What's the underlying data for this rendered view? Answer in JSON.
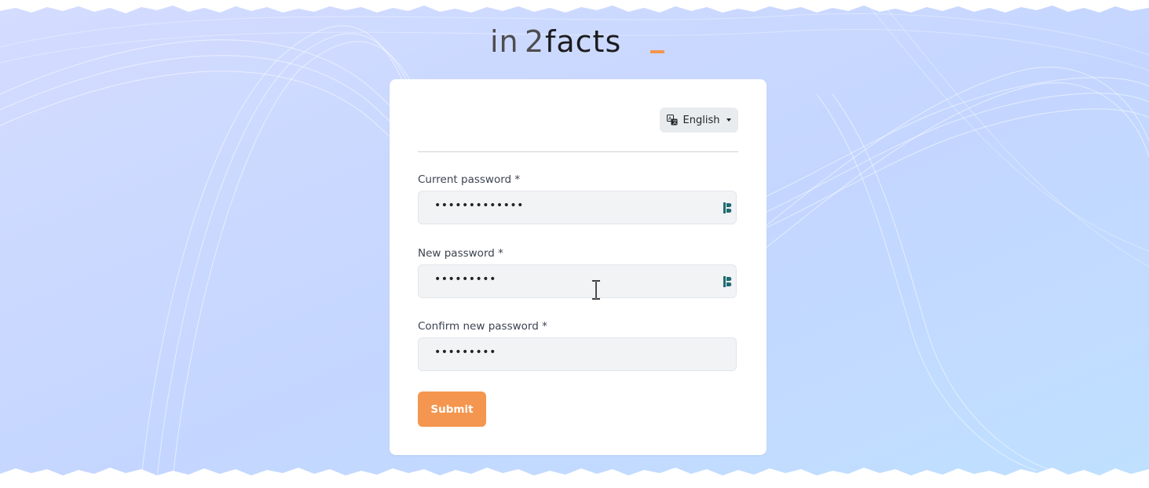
{
  "brand": {
    "logo_text_prefix": "in",
    "logo_text_mid": "2",
    "logo_text_suffix": "facts",
    "accent_color": "#f4964f"
  },
  "language": {
    "selected": "English",
    "icon": "translate-icon"
  },
  "form": {
    "current_password": {
      "label": "Current password *",
      "masked_value": "•••••••••••••"
    },
    "new_password": {
      "label": "New password *",
      "masked_value": "•••••••••"
    },
    "confirm_password": {
      "label": "Confirm new password *",
      "masked_value": "•••••••••"
    },
    "submit_label": "Submit"
  },
  "colors": {
    "background_top": "#d6e2ff",
    "background_bottom": "#c2d8ff",
    "input_bg": "#f1f3f5",
    "password_manager_icon": "#1f6b72"
  }
}
